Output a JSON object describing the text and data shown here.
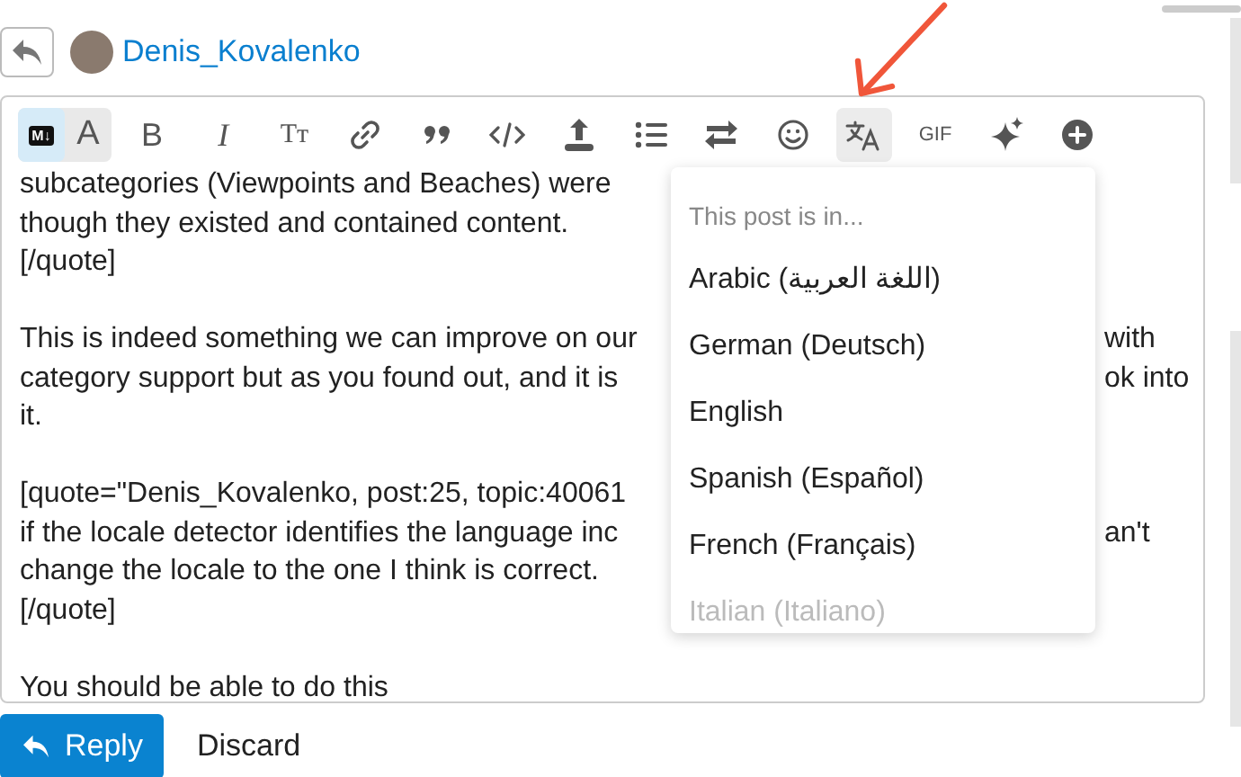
{
  "header": {
    "username": "Denis_Kovalenko"
  },
  "toolbar": {
    "mode_toggle": [
      {
        "label": "M↓",
        "selected": true
      },
      {
        "label": "A",
        "selected": false
      }
    ],
    "tools": [
      {
        "kind": "bold",
        "label": "B",
        "active": false
      },
      {
        "kind": "italic",
        "label": "I",
        "active": false
      },
      {
        "kind": "heading",
        "label": "Tт",
        "active": false
      },
      {
        "kind": "link",
        "active": false
      },
      {
        "kind": "quote",
        "active": false
      },
      {
        "kind": "code",
        "active": false
      },
      {
        "kind": "upload",
        "active": false
      },
      {
        "kind": "list",
        "active": false
      },
      {
        "kind": "swap",
        "active": false
      },
      {
        "kind": "emoji",
        "active": false
      },
      {
        "kind": "translate",
        "active": true
      },
      {
        "kind": "gif",
        "label": "GIF",
        "active": false
      },
      {
        "kind": "sparkle",
        "active": false
      },
      {
        "kind": "plus",
        "active": false
      }
    ]
  },
  "editor_lines": [
    {
      "left": "subcategories (Viewpoints and Beaches) were"
    },
    {
      "left": "though they existed and contained content."
    },
    {
      "left": "[/quote]"
    },
    {
      "kind": "blank"
    },
    {
      "left": "This is indeed something we can improve on our",
      "right": "with"
    },
    {
      "left": "category support but as you found out, and it is",
      "right": "ok into"
    },
    {
      "left": "it."
    },
    {
      "kind": "blank"
    },
    {
      "left": "[quote=\"Denis_Kovalenko, post:25, topic:40061"
    },
    {
      "left": "if the locale detector identifies the language inc",
      "right": "an't"
    },
    {
      "left": "change the locale to the one I think is correct."
    },
    {
      "left": "[/quote]"
    },
    {
      "kind": "blank"
    },
    {
      "left": "You should be able to do this"
    }
  ],
  "language_menu": {
    "placeholder": "This post is in...",
    "items": [
      {
        "label": "Arabic (اللغة العربية)",
        "faded": false
      },
      {
        "label": "German (Deutsch)",
        "faded": false
      },
      {
        "label": "English",
        "faded": false
      },
      {
        "label": "Spanish (Español)",
        "faded": false
      },
      {
        "label": "French (Français)",
        "faded": false
      },
      {
        "label": "Italian (Italiano)",
        "faded": true
      }
    ]
  },
  "actions": {
    "reply": "Reply",
    "discard": "Discard"
  }
}
